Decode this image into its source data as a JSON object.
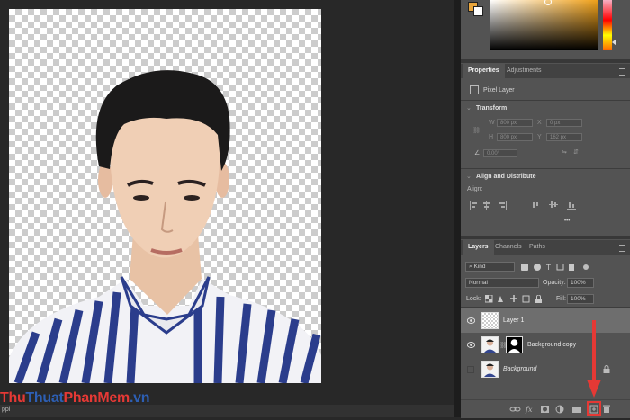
{
  "status_bar": {
    "zoom": "ppi"
  },
  "color_picker": {
    "foreground": "#e8a53c",
    "background": "#ffffff"
  },
  "properties_panel": {
    "tabs": [
      "Properties",
      "Adjustments"
    ],
    "layer_type": "Pixel Layer",
    "transform_label": "Transform",
    "w_label": "W",
    "w_value": "800 px",
    "x_label": "X",
    "x_value": "0 px",
    "h_label": "H",
    "h_value": "800 px",
    "y_label": "Y",
    "y_value": "162 px",
    "angle_value": "0.00°",
    "align_label": "Align and Distribute",
    "align_sub": "Align:",
    "more": "•••"
  },
  "layers_panel": {
    "tabs": [
      "Layers",
      "Channels",
      "Paths"
    ],
    "filter_kind": "Kind",
    "blend_mode": "Normal",
    "opacity_label": "Opacity:",
    "opacity_value": "100%",
    "lock_label": "Lock:",
    "fill_label": "Fill:",
    "fill_value": "100%",
    "layers": [
      {
        "name": "Layer 1",
        "visible": true,
        "selected": true
      },
      {
        "name": "Background copy",
        "visible": true,
        "selected": false
      },
      {
        "name": "Background",
        "visible": false,
        "selected": false,
        "locked": true
      }
    ]
  },
  "watermark": {
    "part1": "Thu",
    "part2": "Thuat",
    "part3": "PhanMem",
    "part4": ".vn"
  },
  "colors": {
    "accent_red": "#e53935",
    "selected_row": "#6e6e6e"
  }
}
